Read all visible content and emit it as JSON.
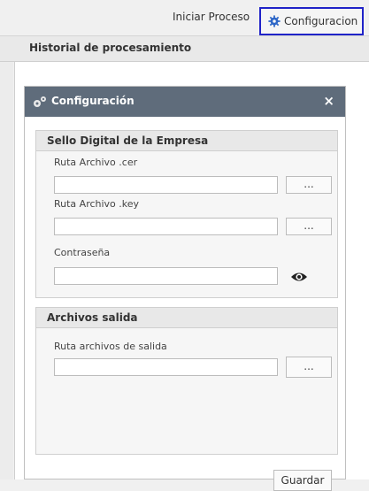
{
  "topbar": {
    "iniciar_proceso": "Iniciar Proceso",
    "configuracion": "Configuracion"
  },
  "subbar": {
    "title": "Historial de procesamiento"
  },
  "dialog": {
    "title": "Configuración",
    "close_label": "×",
    "section1": {
      "title": "Sello Digital de la Empresa",
      "cer_label": "Ruta Archivo .cer",
      "cer_value": "",
      "key_label": "Ruta Archivo .key",
      "key_value": "",
      "password_label": "Contraseña",
      "password_value": "",
      "browse_label": "..."
    },
    "section2": {
      "title": "Archivos salida",
      "output_label": "Ruta archivos de salida",
      "output_value": "",
      "browse_label": "..."
    },
    "save_label": "Guardar"
  }
}
